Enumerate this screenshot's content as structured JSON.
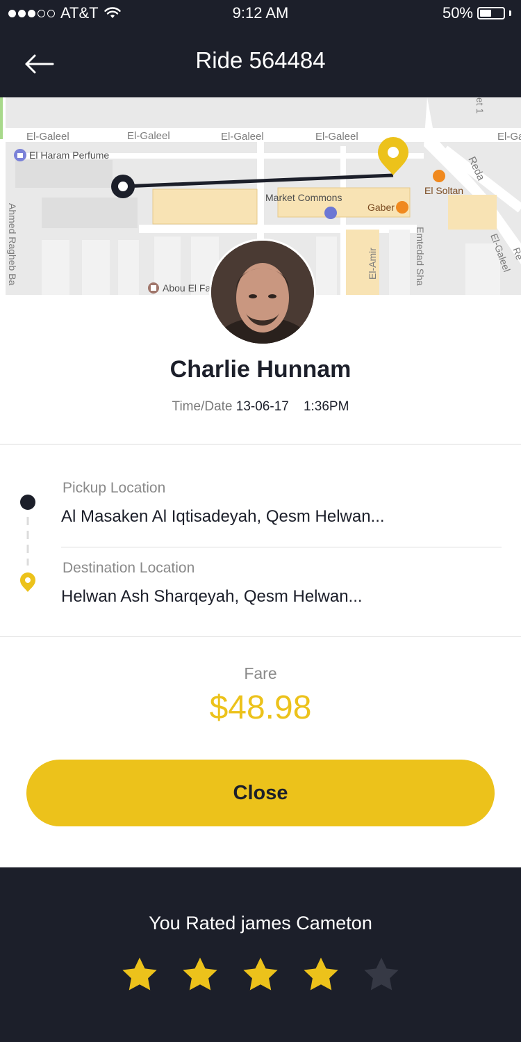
{
  "status_bar": {
    "carrier": "AT&T",
    "time": "9:12 AM",
    "battery": "50%",
    "battery_level": 0.5,
    "signal_bars_filled": 3,
    "signal_bars_total": 5
  },
  "header": {
    "title": "Ride 564484",
    "back_icon": "arrow-left-icon"
  },
  "map": {
    "labels": {
      "street_top_1": "El-Galeel",
      "street_top_2": "El-Galeel",
      "street_top_3": "El-Galeel",
      "street_top_4": "El-Galeel",
      "street_top_5": "El-Ga",
      "poi_perfume": "El Haram Perfume",
      "market": "Market Commons",
      "soltan": "El Soltan",
      "gaber": "Gaber",
      "reda": "Reda",
      "ahmed": "Ahmed Ragheb Ba",
      "amir": "El-Amir",
      "emtedad": "Emtedad Sha",
      "galeel_diag": "El-Galeel",
      "abou": "Abou El Fa",
      "street_1": "et 1",
      "re": "Re"
    }
  },
  "driver": {
    "name": "Charlie Hunnam",
    "datetime_label": "Time/Date",
    "date": "13-06-17",
    "time": "1:36PM"
  },
  "locations": {
    "pickup_label": "Pickup Location",
    "pickup_value": "Al Masaken Al Iqtisadeyah, Qesm Helwan...",
    "destination_label": "Destination Location",
    "destination_value": "Helwan Ash Sharqeyah, Qesm Helwan..."
  },
  "fare": {
    "label": "Fare",
    "value": "$48.98"
  },
  "actions": {
    "close_label": "Close"
  },
  "rating": {
    "text": "You Rated james Cameton",
    "value": 4,
    "max": 5
  },
  "colors": {
    "dark": "#1c1f2a",
    "accent": "#ecc21b",
    "star_off": "#363945"
  }
}
